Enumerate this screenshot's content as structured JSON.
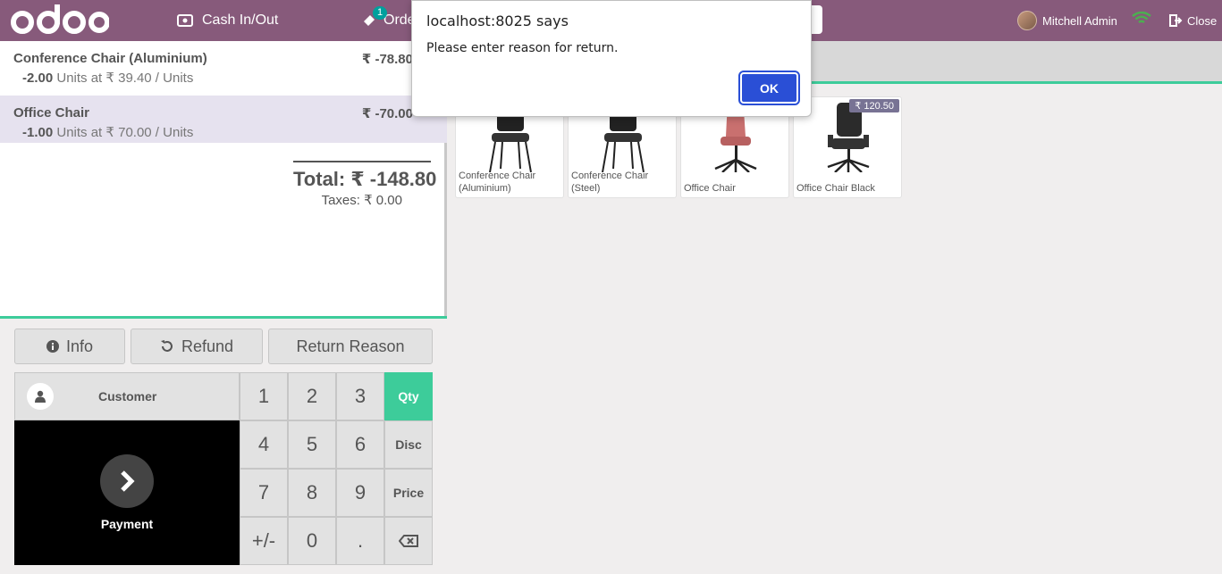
{
  "header": {
    "logo_text": "odoo",
    "cash_label": "Cash In/Out",
    "orders_label": "Orders",
    "orders_badge": "1",
    "user_name": "Mitchell Admin",
    "close_label": "Close"
  },
  "order": {
    "lines": [
      {
        "name": "Conference Chair (Aluminium)",
        "price": "₹ -78.80",
        "qty": "-2.00",
        "unit_text": "Units at ₹ 39.40 / Units"
      },
      {
        "name": "Office Chair",
        "price": "₹ -70.00",
        "qty": "-1.00",
        "unit_text": "Units at ₹ 70.00 / Units"
      }
    ],
    "total": "Total: ₹ -148.80",
    "taxes": "Taxes: ₹ 0.00"
  },
  "controls": {
    "info": "Info",
    "refund": "Refund",
    "return_reason": "Return Reason",
    "customer": "Customer",
    "payment": "Payment"
  },
  "numpad": {
    "k1": "1",
    "k2": "2",
    "k3": "3",
    "k4": "4",
    "k5": "5",
    "k6": "6",
    "k7": "7",
    "k8": "8",
    "k9": "9",
    "plusminus": "+/-",
    "k0": "0",
    "dot": ".",
    "qty": "Qty",
    "disc": "Disc",
    "price": "Price"
  },
  "products": [
    {
      "name": "Conference Chair (Aluminium)",
      "price": ""
    },
    {
      "name": "Conference Chair (Steel)",
      "price": ""
    },
    {
      "name": "Office Chair",
      "price": ""
    },
    {
      "name": "Office Chair Black",
      "price": "₹ 120.50"
    }
  ],
  "dialog": {
    "title": "localhost:8025 says",
    "message": "Please enter reason for return.",
    "ok": "OK"
  },
  "colors": {
    "header": "#875a7b",
    "accent": "#3dcc9a",
    "dialog_button": "#2a4fd6"
  }
}
